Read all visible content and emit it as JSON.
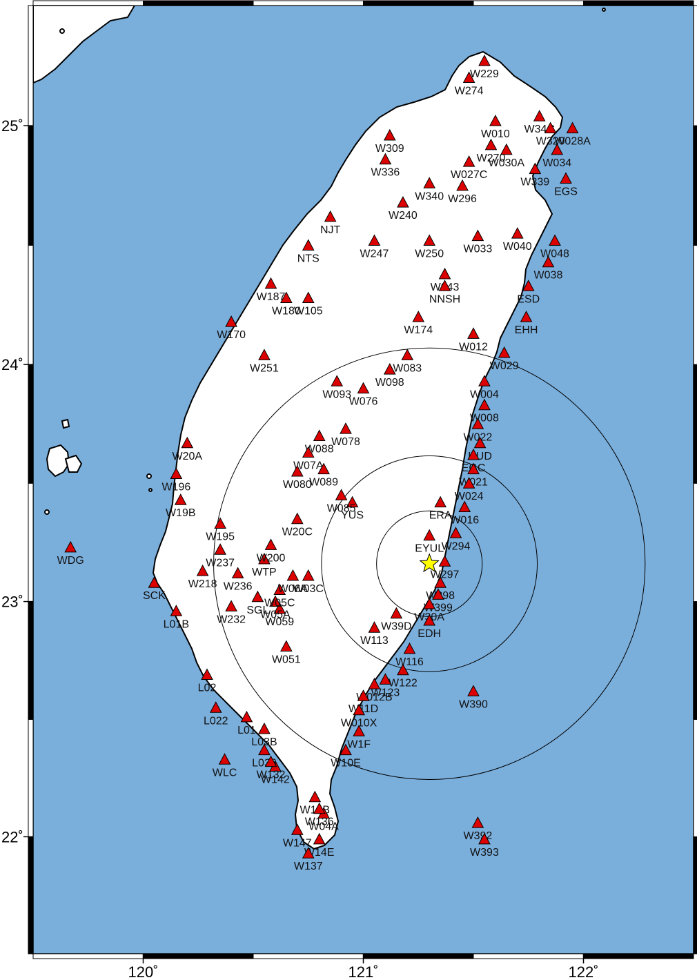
{
  "map": {
    "projection": "mercator",
    "lon_range": [
      119.5,
      122.5
    ],
    "lat_range": [
      21.5,
      25.5
    ],
    "ocean_color": "#7aaedb",
    "land_color": "#ffffff",
    "coast_color": "#000000",
    "station_color": "#dd0000",
    "epicenter_color": "#ffff00",
    "ring_color": "#000000",
    "frame_style": "fancy-checkered"
  },
  "axes": {
    "x_ticks": [
      {
        "value": 120,
        "label": "120˚"
      },
      {
        "value": 121,
        "label": "121˚"
      },
      {
        "value": 122,
        "label": "122˚"
      }
    ],
    "y_ticks": [
      {
        "value": 25,
        "label": "25˚"
      },
      {
        "value": 24,
        "label": "24˚"
      },
      {
        "value": 23,
        "label": "23˚"
      },
      {
        "value": 22,
        "label": "22˚"
      }
    ]
  },
  "epicenter": {
    "name": "epicenter-star-icon",
    "lon": 121.3,
    "lat": 23.16
  },
  "rings": [
    {
      "radius_deg": 0.24
    },
    {
      "radius_deg": 0.49
    },
    {
      "radius_deg": 0.98
    }
  ],
  "stations": [
    {
      "id": "W229",
      "lon": 121.55,
      "lat": 25.27
    },
    {
      "id": "W274",
      "lon": 121.48,
      "lat": 25.2
    },
    {
      "id": "W34C",
      "lon": 121.8,
      "lat": 25.04
    },
    {
      "id": "W028A",
      "lon": 121.95,
      "lat": 24.99
    },
    {
      "id": "W320",
      "lon": 121.85,
      "lat": 24.99
    },
    {
      "id": "W010",
      "lon": 121.6,
      "lat": 25.02
    },
    {
      "id": "W270",
      "lon": 121.58,
      "lat": 24.92
    },
    {
      "id": "W030A",
      "lon": 121.65,
      "lat": 24.9
    },
    {
      "id": "W034",
      "lon": 121.88,
      "lat": 24.9
    },
    {
      "id": "W339",
      "lon": 121.78,
      "lat": 24.82
    },
    {
      "id": "EGS",
      "lon": 121.92,
      "lat": 24.78
    },
    {
      "id": "W027C",
      "lon": 121.48,
      "lat": 24.85
    },
    {
      "id": "W296",
      "lon": 121.45,
      "lat": 24.75
    },
    {
      "id": "W336",
      "lon": 121.1,
      "lat": 24.86
    },
    {
      "id": "W309",
      "lon": 121.12,
      "lat": 24.96
    },
    {
      "id": "W340",
      "lon": 121.3,
      "lat": 24.76
    },
    {
      "id": "W240",
      "lon": 121.18,
      "lat": 24.68
    },
    {
      "id": "W247",
      "lon": 121.05,
      "lat": 24.52
    },
    {
      "id": "W250",
      "lon": 121.3,
      "lat": 24.52
    },
    {
      "id": "W033",
      "lon": 121.52,
      "lat": 24.54
    },
    {
      "id": "W040",
      "lon": 121.7,
      "lat": 24.55
    },
    {
      "id": "W048",
      "lon": 121.87,
      "lat": 24.52
    },
    {
      "id": "W038",
      "lon": 121.84,
      "lat": 24.43
    },
    {
      "id": "NJT",
      "lon": 120.85,
      "lat": 24.62
    },
    {
      "id": "NTS",
      "lon": 120.75,
      "lat": 24.5
    },
    {
      "id": "W043",
      "lon": 121.37,
      "lat": 24.38
    },
    {
      "id": "NNSH",
      "lon": 121.37,
      "lat": 24.33
    },
    {
      "id": "ESD",
      "lon": 121.75,
      "lat": 24.33
    },
    {
      "id": "EHH",
      "lon": 121.74,
      "lat": 24.2
    },
    {
      "id": "W174",
      "lon": 121.25,
      "lat": 24.2
    },
    {
      "id": "W012",
      "lon": 121.5,
      "lat": 24.13
    },
    {
      "id": "W029",
      "lon": 121.64,
      "lat": 24.05
    },
    {
      "id": "W083",
      "lon": 121.2,
      "lat": 24.04
    },
    {
      "id": "W098",
      "lon": 121.12,
      "lat": 23.98
    },
    {
      "id": "W076",
      "lon": 121.0,
      "lat": 23.9
    },
    {
      "id": "W078",
      "lon": 120.92,
      "lat": 23.73
    },
    {
      "id": "W004",
      "lon": 121.55,
      "lat": 23.93
    },
    {
      "id": "W008",
      "lon": 121.55,
      "lat": 23.83
    },
    {
      "id": "W022",
      "lon": 121.52,
      "lat": 23.75
    },
    {
      "id": "HUD",
      "lon": 121.53,
      "lat": 23.67
    },
    {
      "id": "EGC",
      "lon": 121.5,
      "lat": 23.62
    },
    {
      "id": "W021",
      "lon": 121.5,
      "lat": 23.56
    },
    {
      "id": "W024",
      "lon": 121.48,
      "lat": 23.5
    },
    {
      "id": "W016",
      "lon": 121.46,
      "lat": 23.4
    },
    {
      "id": "ERA",
      "lon": 121.35,
      "lat": 23.42
    },
    {
      "id": "YUS",
      "lon": 120.95,
      "lat": 23.42
    },
    {
      "id": "EYUL",
      "lon": 121.3,
      "lat": 23.28
    },
    {
      "id": "W294",
      "lon": 121.42,
      "lat": 23.29
    },
    {
      "id": "W297",
      "lon": 121.37,
      "lat": 23.17
    },
    {
      "id": "W398",
      "lon": 121.35,
      "lat": 23.08
    },
    {
      "id": "W399",
      "lon": 121.34,
      "lat": 23.03
    },
    {
      "id": "W30A",
      "lon": 121.3,
      "lat": 22.99
    },
    {
      "id": "EDH",
      "lon": 121.3,
      "lat": 22.92
    },
    {
      "id": "W39D",
      "lon": 121.15,
      "lat": 22.95
    },
    {
      "id": "W113",
      "lon": 121.05,
      "lat": 22.89
    },
    {
      "id": "W116",
      "lon": 121.21,
      "lat": 22.8
    },
    {
      "id": "W122",
      "lon": 121.18,
      "lat": 22.71
    },
    {
      "id": "W123",
      "lon": 121.1,
      "lat": 22.67
    },
    {
      "id": "W012B",
      "lon": 121.05,
      "lat": 22.65
    },
    {
      "id": "W11D",
      "lon": 121.0,
      "lat": 22.6
    },
    {
      "id": "W010X",
      "lon": 120.98,
      "lat": 22.54
    },
    {
      "id": "W1F",
      "lon": 120.98,
      "lat": 22.45
    },
    {
      "id": "W10E",
      "lon": 120.92,
      "lat": 22.37
    },
    {
      "id": "W390",
      "lon": 121.5,
      "lat": 22.62
    },
    {
      "id": "W392",
      "lon": 121.52,
      "lat": 22.06
    },
    {
      "id": "W393",
      "lon": 121.55,
      "lat": 21.99
    },
    {
      "id": "WDG",
      "lon": 119.67,
      "lat": 23.23
    },
    {
      "id": "WLC",
      "lon": 120.37,
      "lat": 22.33
    },
    {
      "id": "W142",
      "lon": 120.6,
      "lat": 22.3
    },
    {
      "id": "W147",
      "lon": 120.7,
      "lat": 22.03
    },
    {
      "id": "W14B",
      "lon": 120.78,
      "lat": 22.17
    },
    {
      "id": "W04A",
      "lon": 120.82,
      "lat": 22.1
    },
    {
      "id": "W136",
      "lon": 120.8,
      "lat": 22.12
    },
    {
      "id": "W14E",
      "lon": 120.8,
      "lat": 21.99
    },
    {
      "id": "W137",
      "lon": 120.75,
      "lat": 21.93
    },
    {
      "id": "L022",
      "lon": 120.33,
      "lat": 22.55
    },
    {
      "id": "L01",
      "lon": 120.47,
      "lat": 22.51
    },
    {
      "id": "L03B",
      "lon": 120.55,
      "lat": 22.46
    },
    {
      "id": "L036",
      "lon": 120.55,
      "lat": 22.37
    },
    {
      "id": "W132",
      "lon": 120.58,
      "lat": 22.32
    },
    {
      "id": "L02",
      "lon": 120.29,
      "lat": 22.69
    },
    {
      "id": "W051",
      "lon": 120.65,
      "lat": 22.81
    },
    {
      "id": "W059",
      "lon": 120.62,
      "lat": 22.97
    },
    {
      "id": "W05A",
      "lon": 120.6,
      "lat": 23.0
    },
    {
      "id": "W05C",
      "lon": 120.62,
      "lat": 23.05
    },
    {
      "id": "SGL",
      "lon": 120.52,
      "lat": 23.02
    },
    {
      "id": "W232",
      "lon": 120.4,
      "lat": 22.98
    },
    {
      "id": "W236",
      "lon": 120.43,
      "lat": 23.12
    },
    {
      "id": "WTP",
      "lon": 120.55,
      "lat": 23.18
    },
    {
      "id": "W200",
      "lon": 120.58,
      "lat": 23.24
    },
    {
      "id": "W237",
      "lon": 120.35,
      "lat": 23.22
    },
    {
      "id": "W218",
      "lon": 120.27,
      "lat": 23.13
    },
    {
      "id": "SCK",
      "lon": 120.05,
      "lat": 23.08
    },
    {
      "id": "L01B",
      "lon": 120.15,
      "lat": 22.96
    },
    {
      "id": "W195",
      "lon": 120.35,
      "lat": 23.33
    },
    {
      "id": "W19B",
      "lon": 120.17,
      "lat": 23.43
    },
    {
      "id": "W196",
      "lon": 120.15,
      "lat": 23.54
    },
    {
      "id": "W20A",
      "lon": 120.2,
      "lat": 23.67
    },
    {
      "id": "W170",
      "lon": 120.4,
      "lat": 24.18
    },
    {
      "id": "W251",
      "lon": 120.55,
      "lat": 24.04
    },
    {
      "id": "W187",
      "lon": 120.58,
      "lat": 24.34
    },
    {
      "id": "W180",
      "lon": 120.65,
      "lat": 24.28
    },
    {
      "id": "W105",
      "lon": 120.75,
      "lat": 24.28
    },
    {
      "id": "W093",
      "lon": 120.88,
      "lat": 23.93
    },
    {
      "id": "W088",
      "lon": 120.8,
      "lat": 23.7
    },
    {
      "id": "W07A",
      "lon": 120.75,
      "lat": 23.63
    },
    {
      "id": "W080",
      "lon": 120.7,
      "lat": 23.55
    },
    {
      "id": "W089",
      "lon": 120.82,
      "lat": 23.56
    },
    {
      "id": "W085",
      "lon": 120.9,
      "lat": 23.45
    },
    {
      "id": "W20C",
      "lon": 120.7,
      "lat": 23.35
    },
    {
      "id": "W03C",
      "lon": 120.75,
      "lat": 23.11
    },
    {
      "id": "W06A",
      "lon": 120.68,
      "lat": 23.11
    }
  ]
}
